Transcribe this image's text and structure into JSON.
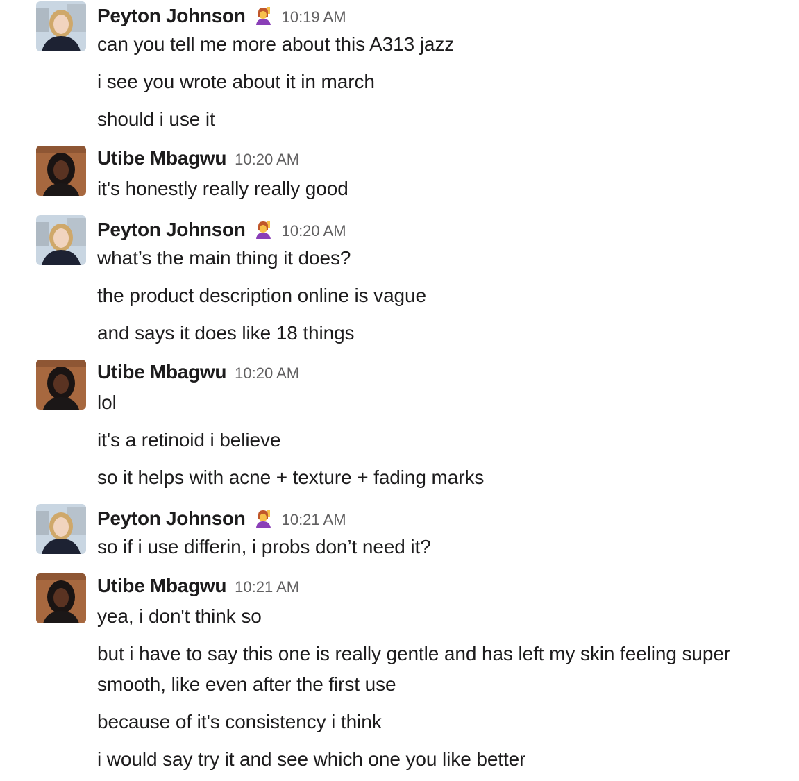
{
  "messages": [
    {
      "sender": "Peyton Johnson",
      "status_emoji": "person-raising-hand-emoji",
      "time": "10:19 AM",
      "lines": [
        "can you tell me more about this A313 jazz",
        "i see you wrote about it in march",
        "should i use it"
      ]
    },
    {
      "sender": "Utibe Mbagwu",
      "time": "10:20 AM",
      "lines": [
        "it's honestly really really good"
      ]
    },
    {
      "sender": "Peyton Johnson",
      "status_emoji": "person-raising-hand-emoji",
      "time": "10:20 AM",
      "lines": [
        "what’s the main thing it does?",
        "the product description online is vague",
        "and says it does like 18 things"
      ]
    },
    {
      "sender": "Utibe Mbagwu",
      "time": "10:20 AM",
      "lines": [
        "lol",
        "it's a retinoid i believe",
        "so it helps with acne + texture + fading marks"
      ]
    },
    {
      "sender": "Peyton Johnson",
      "status_emoji": "person-raising-hand-emoji",
      "time": "10:21 AM",
      "lines": [
        "so if i use differin, i probs don’t need it?"
      ]
    },
    {
      "sender": "Utibe Mbagwu",
      "time": "10:21 AM",
      "lines": [
        "yea, i don't think so",
        "but i have to say this one is really gentle and has left my skin feeling super",
        "smooth, like even after the first use",
        "because of it's consistency i think",
        "i would say try it and see which one you like better"
      ]
    }
  ]
}
